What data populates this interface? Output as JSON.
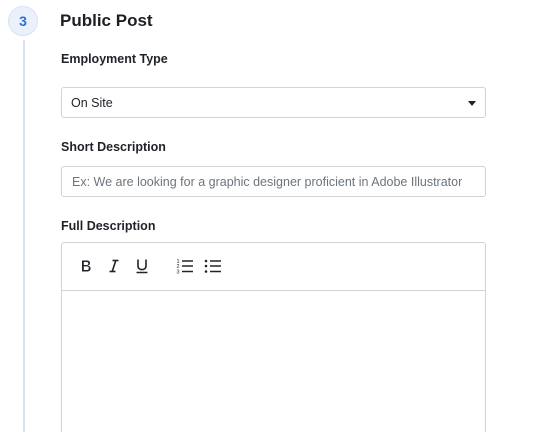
{
  "step": {
    "number": "3",
    "title": "Public Post"
  },
  "employment_type": {
    "label": "Employment Type",
    "selected": "On Site"
  },
  "short_description": {
    "label": "Short Description",
    "placeholder": "Ex: We are looking for a graphic designer proficient in Adobe Illustrator",
    "value": ""
  },
  "full_description": {
    "label": "Full Description",
    "toolbar": [
      "bold-icon",
      "italic-icon",
      "underline-icon",
      "ordered-list-icon",
      "unordered-list-icon"
    ],
    "content": ""
  },
  "colors": {
    "accent": "#2f6fd6",
    "step_bg": "#eaf1fb",
    "border": "#ced4da",
    "timeline": "#d7e3f2"
  }
}
